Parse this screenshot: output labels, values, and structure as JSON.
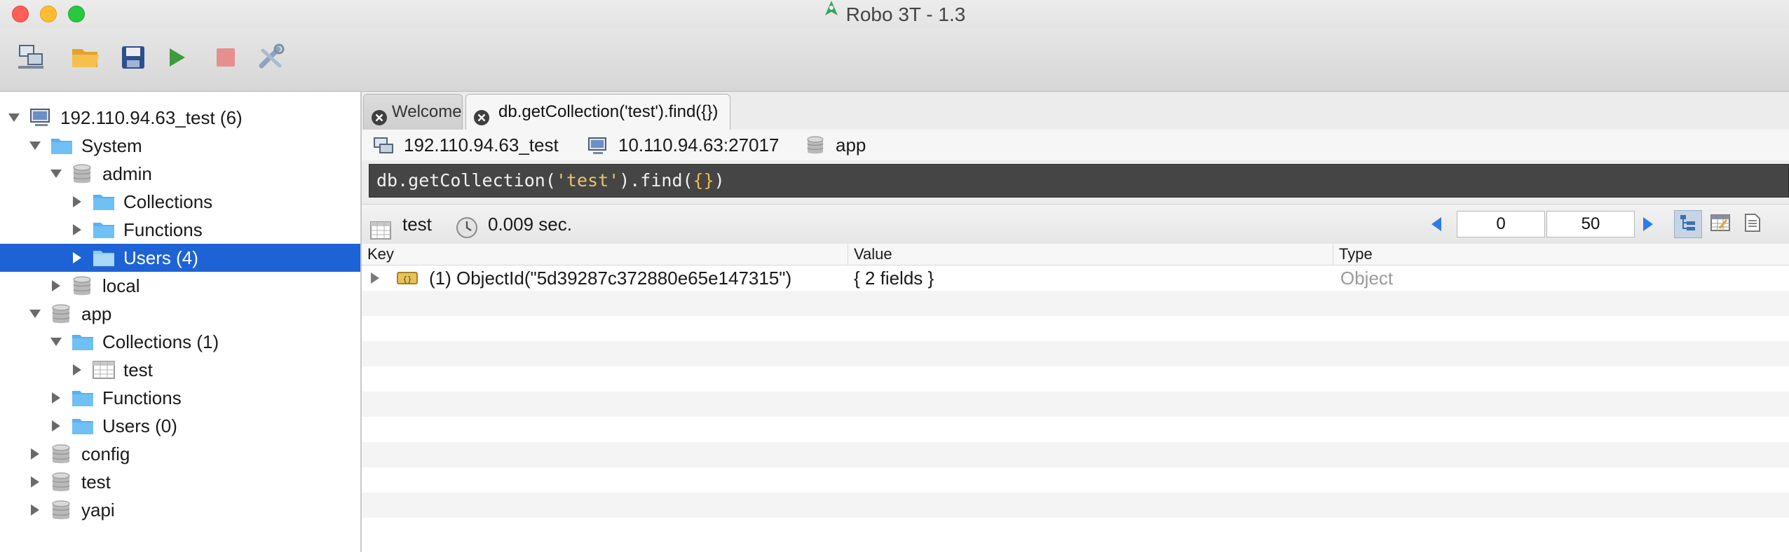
{
  "window": {
    "title": "Robo 3T - 1.3"
  },
  "toolbar": {
    "buttons": [
      "connect-icon",
      "open-icon",
      "save-icon",
      "execute-icon",
      "stop-icon",
      "robomongo-icon"
    ]
  },
  "sidebar": {
    "server": "192.110.94.63_test (6)",
    "system": "System",
    "admin": "admin",
    "admin_collections": "Collections",
    "admin_functions": "Functions",
    "admin_users": "Users (4)",
    "local": "local",
    "app": "app",
    "app_collections": "Collections (1)",
    "app_test": "test",
    "app_functions": "Functions",
    "app_users": "Users (0)",
    "config": "config",
    "test": "test",
    "yapi": "yapi"
  },
  "tabs": [
    {
      "label": "Welcome"
    },
    {
      "label": "db.getCollection('test').find({})"
    }
  ],
  "connection": {
    "server": "192.110.94.63_test",
    "host": "10.110.94.63:27017",
    "database": "app"
  },
  "query": {
    "prefix": "db.getCollection(",
    "string": "'test'",
    "middle": ").find(",
    "braces": "{}",
    "suffix": ")"
  },
  "results": {
    "collection": "test",
    "time": "0.009 sec.",
    "skip": "0",
    "limit": "50",
    "columns": {
      "key": "Key",
      "value": "Value",
      "type": "Type"
    },
    "rows": [
      {
        "key": "(1) ObjectId(\"5d39287c372880e65e147315\")",
        "value": "{ 2 fields }",
        "type": "Object"
      }
    ]
  },
  "colors": {
    "selection": "#1e63d6",
    "folder": "#5ab1ef",
    "query_bg": "#454545"
  }
}
